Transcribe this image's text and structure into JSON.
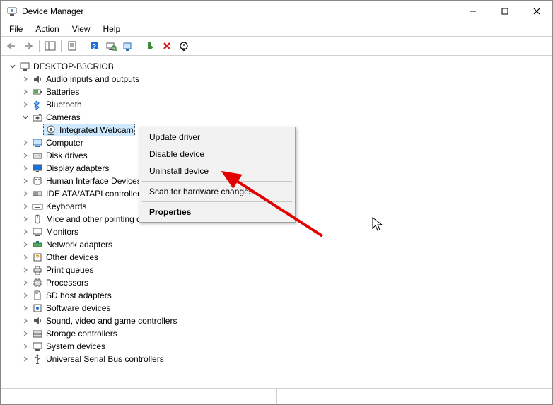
{
  "window": {
    "title": "Device Manager"
  },
  "menubar": {
    "file": "File",
    "action": "Action",
    "view": "View",
    "help": "Help"
  },
  "tree": {
    "root": "DESKTOP-B3CRIOB",
    "items": [
      "Audio inputs and outputs",
      "Batteries",
      "Bluetooth",
      "Cameras",
      "Computer",
      "Disk drives",
      "Display adapters",
      "Human Interface Devices",
      "IDE ATA/ATAPI controllers",
      "Keyboards",
      "Mice and other pointing devices",
      "Monitors",
      "Network adapters",
      "Other devices",
      "Print queues",
      "Processors",
      "SD host adapters",
      "Software devices",
      "Sound, video and game controllers",
      "Storage controllers",
      "System devices",
      "Universal Serial Bus controllers"
    ],
    "cameras_child": "Integrated Webcam"
  },
  "context_menu": {
    "update": "Update driver",
    "disable": "Disable device",
    "uninstall": "Uninstall device",
    "scan": "Scan for hardware changes",
    "properties": "Properties"
  }
}
